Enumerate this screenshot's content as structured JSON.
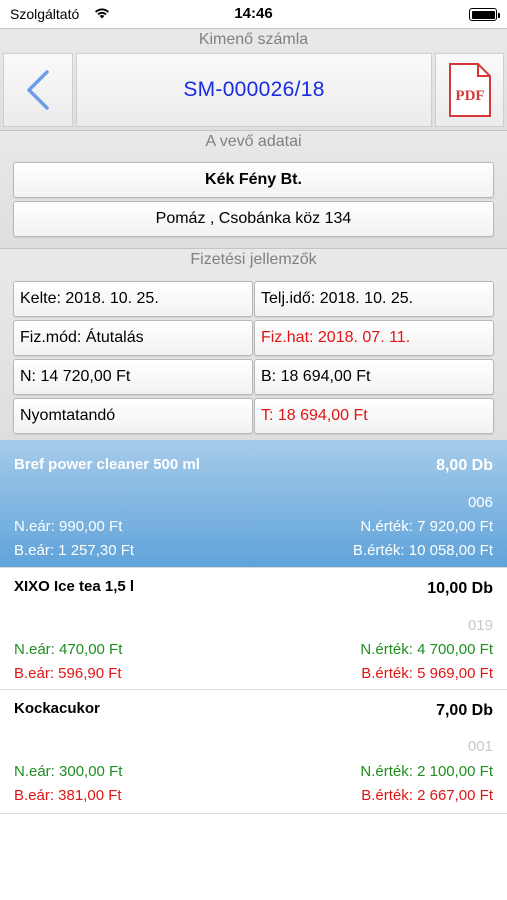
{
  "status_bar": {
    "carrier": "Szolgáltató",
    "time": "14:46"
  },
  "header": {
    "section_title": "Kimenő számla",
    "invoice_number": "SM-000026/18",
    "pdf_label": "PDF"
  },
  "customer": {
    "section_title": "A vevő adatai",
    "name": "Kék Fény Bt.",
    "address": "Pomáz , Csobánka köz 134"
  },
  "payment": {
    "section_title": "Fizetési jellemzők",
    "issue_date": "Kelte: 2018. 10. 25.",
    "fulfillment_date": "Telj.idő: 2018. 10. 25.",
    "method": "Fiz.mód: Átutalás",
    "due_date": "Fiz.hat: 2018. 07. 11.",
    "net": "N: 14 720,00 Ft",
    "gross": "B: 18 694,00 Ft",
    "print_status": "Nyomtatandó",
    "total": "T: 18 694,00 Ft"
  },
  "items": [
    {
      "name": "Bref power cleaner 500 ml",
      "qty": "8,00 Db",
      "code": "006",
      "net_price": "N.eár: 990,00 Ft",
      "net_value": "N.érték: 7 920,00 Ft",
      "gross_price": "B.eár: 1 257,30 Ft",
      "gross_value": "B.érték: 10 058,00 Ft"
    },
    {
      "name": "XIXO Ice tea 1,5 l",
      "qty": "10,00 Db",
      "code": "019",
      "net_price": "N.eár: 470,00 Ft",
      "net_value": "N.érték: 4 700,00 Ft",
      "gross_price": "B.eár: 596,90 Ft",
      "gross_value": "B.érték: 5 969,00 Ft"
    },
    {
      "name": "Kockacukor",
      "qty": "7,00 Db",
      "code": "001",
      "net_price": "N.eár: 300,00 Ft",
      "net_value": "N.érték: 2 100,00 Ft",
      "gross_price": "B.eár: 381,00 Ft",
      "gross_value": "B.érték: 2 667,00 Ft"
    }
  ],
  "colors": {
    "title_blue": "#1a2be0",
    "alert_red": "#e01515",
    "net_green": "#1f8f1f",
    "selected_blue": "#5fa3da"
  }
}
